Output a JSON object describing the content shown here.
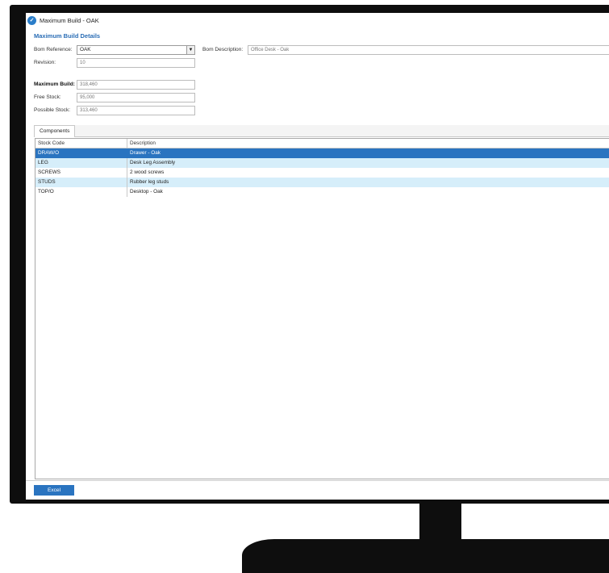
{
  "window": {
    "title": "Maximum Build - OAK",
    "section_title": "Maximum Build Details"
  },
  "form": {
    "bom_reference_label": "Bom Reference:",
    "bom_reference_value": "OAK",
    "bom_description_label": "Bom Description:",
    "bom_description_value": "Office Desk - Oak",
    "revision_label": "Revision:",
    "revision_value": "10",
    "maximum_build_label": "Maximum Build:",
    "maximum_build_value": "318,460",
    "free_stock_label": "Free Stock:",
    "free_stock_value": "95,000",
    "possible_stock_label": "Possible Stock:",
    "possible_stock_value": "313,460"
  },
  "tabs": [
    {
      "label": "Components"
    }
  ],
  "grid": {
    "columns": [
      "Stock Code",
      "Description"
    ],
    "rows": [
      {
        "code": "DRAW/O",
        "description": "Drawer - Oak"
      },
      {
        "code": "LEG",
        "description": "Desk Leg Assembly"
      },
      {
        "code": "SCREWS",
        "description": "2 wood screws"
      },
      {
        "code": "STUDS",
        "description": "Rubber leg studs"
      },
      {
        "code": "TOP/O",
        "description": "Desktop - Oak"
      }
    ],
    "selected_row_index": 0
  },
  "footer": {
    "excel_label": "Excel"
  },
  "colors": {
    "accent": "#2a74c0",
    "section_title": "#2a6db5",
    "alt_row": "#d6eefa"
  },
  "icons": {
    "app": "app-logo-icon",
    "dropdown": "chevron-down-icon"
  }
}
